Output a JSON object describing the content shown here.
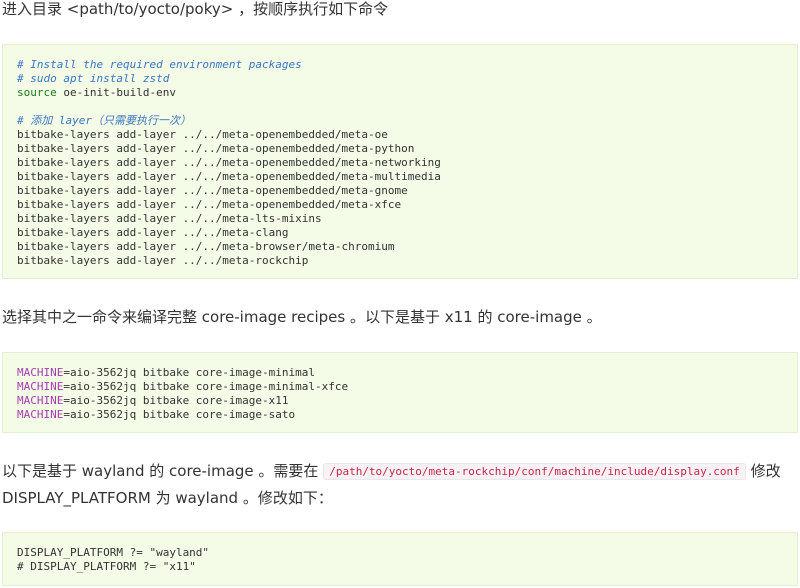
{
  "intro_text": "进入目录 <path/to/yocto/poky> ，按顺序执行如下命令",
  "block1": {
    "comment_install": "# Install the required environment packages",
    "comment_sudo": "# sudo apt install zstd",
    "source_kw": "source",
    "source_arg": " oe-init-build-env",
    "comment_layer": "# 添加 layer（只需要执行一次）",
    "layer_lines": [
      "bitbake-layers add-layer ../../meta-openembedded/meta-oe",
      "bitbake-layers add-layer ../../meta-openembedded/meta-python",
      "bitbake-layers add-layer ../../meta-openembedded/meta-networking",
      "bitbake-layers add-layer ../../meta-openembedded/meta-multimedia",
      "bitbake-layers add-layer ../../meta-openembedded/meta-gnome",
      "bitbake-layers add-layer ../../meta-openembedded/meta-xfce",
      "bitbake-layers add-layer ../../meta-lts-mixins",
      "bitbake-layers add-layer ../../meta-clang",
      "bitbake-layers add-layer ../../meta-browser/meta-chromium",
      "bitbake-layers add-layer ../../meta-rockchip"
    ]
  },
  "select_text": "选择其中之一命令来编译完整 core-image recipes 。以下是基于 x11 的 core-image 。",
  "block2": {
    "machine_var": "MACHINE",
    "machine_cmds": [
      "=aio-3562jq bitbake core-image-minimal",
      "=aio-3562jq bitbake core-image-minimal-xfce",
      "=aio-3562jq bitbake core-image-x11",
      "=aio-3562jq bitbake core-image-sato"
    ]
  },
  "wayland_text": {
    "part1": "以下是基于 wayland 的 core-image 。需要在 ",
    "path": "/path/to/yocto/meta-rockchip/conf/machine/include/display.conf",
    "part2": " 修改",
    "line2": "DISPLAY_PLATFORM 为 wayland 。修改如下："
  },
  "block3": {
    "lines": [
      "DISPLAY_PLATFORM ?= \"wayland\"",
      "# DISPLAY_PLATFORM ?= \"x11\""
    ]
  }
}
